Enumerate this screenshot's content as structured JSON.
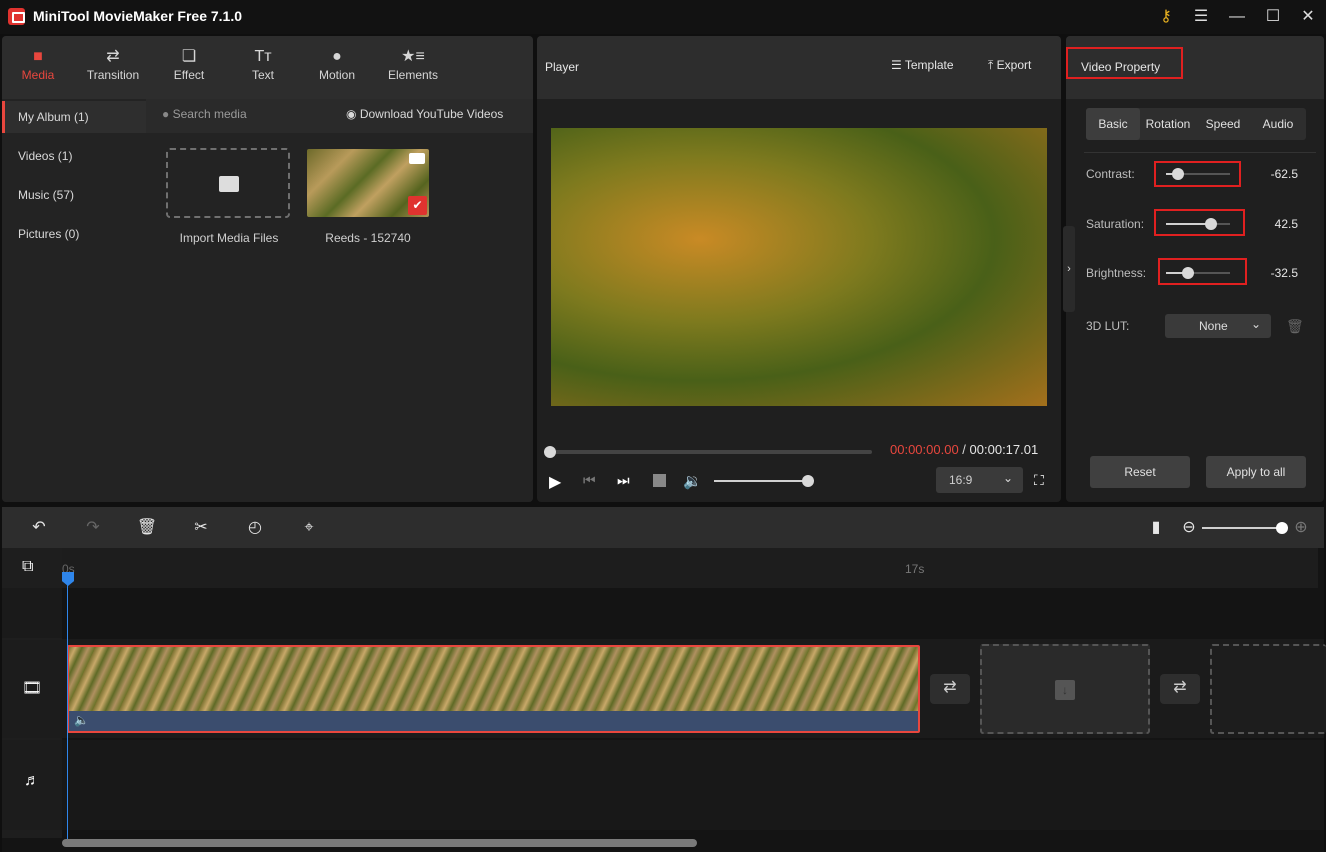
{
  "app": {
    "title": "MiniTool MovieMaker Free 7.1.0"
  },
  "window_controls": {
    "key": "key-icon",
    "menu": "menu-icon",
    "minimize": "minimize-icon",
    "maximize": "maximize-icon",
    "close": "close-icon"
  },
  "toolbar_tabs": [
    {
      "label": "Media",
      "icon": "folder-icon",
      "active": true
    },
    {
      "label": "Transition",
      "icon": "swap-icon"
    },
    {
      "label": "Effect",
      "icon": "layers-icon"
    },
    {
      "label": "Text",
      "icon": "text-icon"
    },
    {
      "label": "Motion",
      "icon": "motion-icon"
    },
    {
      "label": "Elements",
      "icon": "elements-icon"
    }
  ],
  "album": {
    "items": [
      {
        "label": "My Album (1)",
        "active": true
      },
      {
        "label": "Videos (1)"
      },
      {
        "label": "Music (57)"
      },
      {
        "label": "Pictures (0)"
      }
    ]
  },
  "media": {
    "search_placeholder": "Search media",
    "download_label": "Download YouTube Videos",
    "import_label": "Import Media Files",
    "clip_name": "Reeds - 152740"
  },
  "player": {
    "title": "Player",
    "template_label": "Template",
    "export_label": "Export",
    "current_time": "00:00:00.00",
    "separator": " / ",
    "total_time": "00:00:17.01",
    "progress": 0,
    "volume": 1.0,
    "aspect_ratio": "16:9"
  },
  "property": {
    "title": "Video Property",
    "tabs": [
      "Basic",
      "Rotation",
      "Speed",
      "Audio"
    ],
    "active_tab": "Basic",
    "contrast": {
      "label": "Contrast:",
      "value": "-62.5",
      "fraction": 0.19
    },
    "saturation": {
      "label": "Saturation:",
      "value": "42.5",
      "fraction": 0.71
    },
    "brightness": {
      "label": "Brightness:",
      "value": "-32.5",
      "fraction": 0.34
    },
    "lut": {
      "label": "3D LUT:",
      "value": "None"
    },
    "reset_label": "Reset",
    "apply_label": "Apply to all"
  },
  "timeline": {
    "ruler_start": "0s",
    "ruler_end": "17s",
    "zoom_level": 1.0,
    "scroll_fraction": 0.5
  },
  "colors": {
    "accent": "#e8473e",
    "playhead": "#2f86eb",
    "timecode_current": "#e8473e"
  }
}
